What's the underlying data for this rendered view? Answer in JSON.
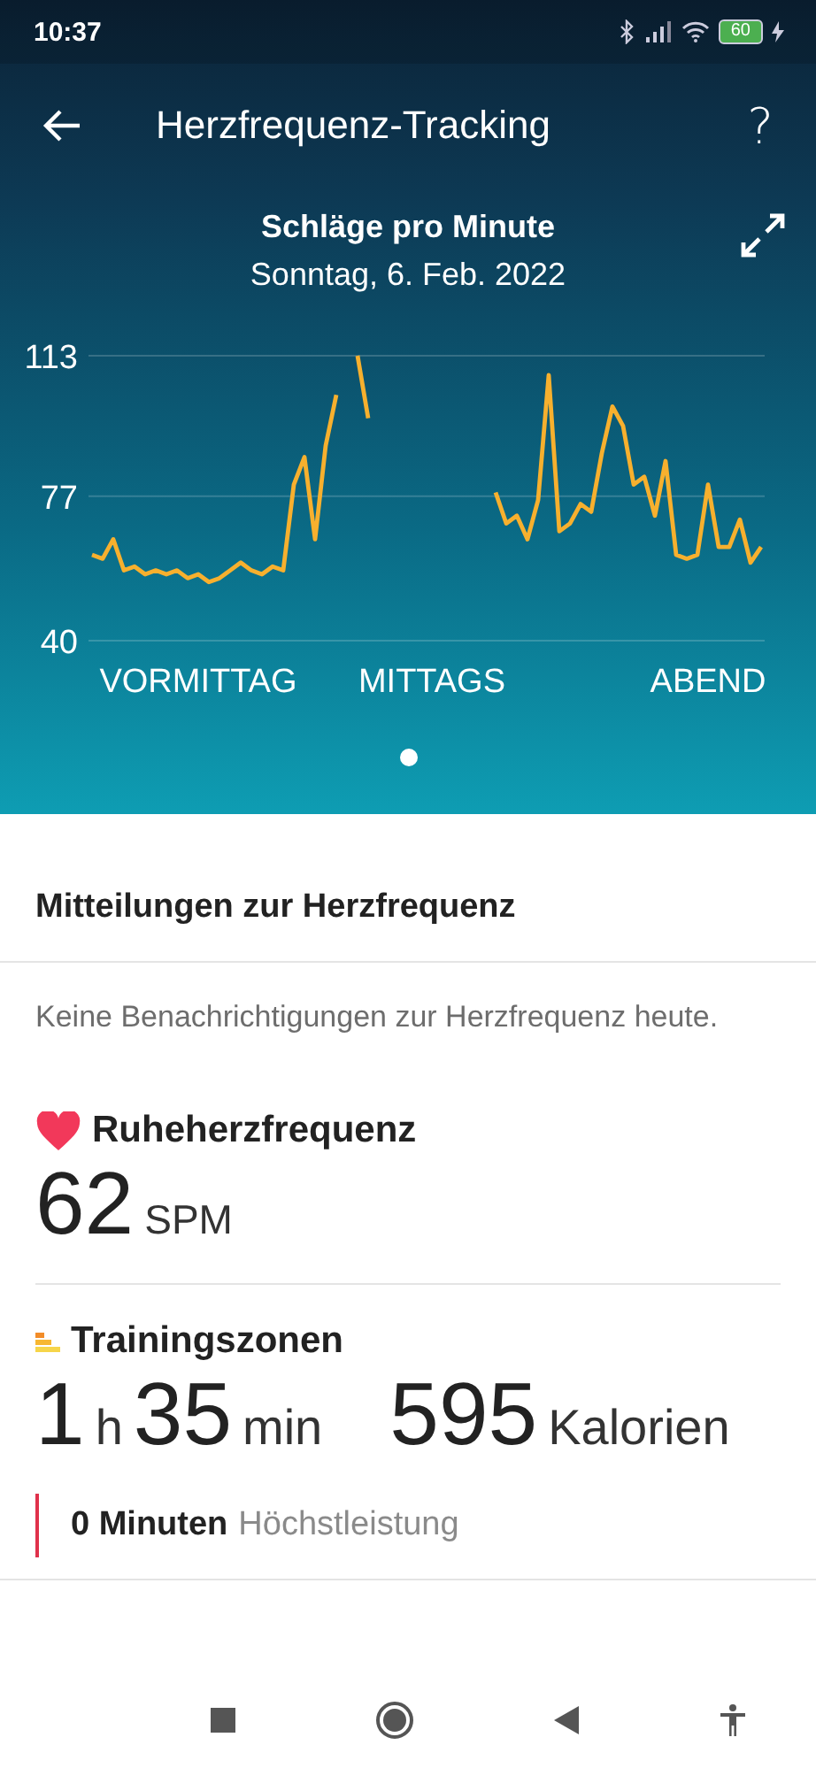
{
  "status_bar": {
    "time": "10:37",
    "battery": "60"
  },
  "app_bar": {
    "title": "Herzfrequenz-Tracking",
    "help": "?"
  },
  "chart_header": {
    "title": "Schläge pro Minute",
    "date": "Sonntag, 6. Feb. 2022"
  },
  "chart_data": {
    "type": "line",
    "ylim": [
      40,
      113
    ],
    "yticks": [
      40,
      77,
      113
    ],
    "categories": [
      null,
      null,
      null,
      null,
      null,
      null,
      null,
      null,
      null,
      null,
      "VORMITTAG",
      null,
      null,
      null,
      null,
      null,
      null,
      null,
      null,
      null,
      null,
      null,
      null,
      null,
      null,
      null,
      null,
      null,
      null,
      null,
      null,
      null,
      "MITTAGS",
      null,
      null,
      null,
      null,
      null,
      null,
      null,
      null,
      null,
      null,
      null,
      null,
      null,
      null,
      null,
      null,
      null,
      null,
      null,
      null,
      null,
      null,
      null,
      null,
      null,
      "ABEND",
      null,
      null,
      null,
      null,
      null
    ],
    "series": [
      {
        "color": "#f7b02e",
        "values": [
          62,
          61,
          66,
          58,
          59,
          57,
          58,
          57,
          58,
          56,
          57,
          55,
          56,
          58,
          60,
          58,
          57,
          59,
          58,
          80,
          87,
          66,
          90,
          103,
          null,
          113,
          97,
          null,
          null,
          null,
          null,
          null,
          null,
          null,
          null,
          null,
          null,
          null,
          78,
          70,
          72,
          66,
          76,
          108,
          68,
          70,
          75,
          73,
          88,
          100,
          95,
          80,
          82,
          72,
          86,
          62,
          61,
          62,
          80,
          64,
          64,
          71,
          60,
          64
        ]
      }
    ]
  },
  "pager": {
    "pages": [
      {
        "selected": true
      }
    ]
  },
  "notifications": {
    "title": "Mitteilungen zur Herzfrequenz",
    "message": "Keine Benachrichtigungen zur Herzfrequenz heute."
  },
  "resting": {
    "title": "Ruheherzfrequenz",
    "value": "62",
    "unit": "SPM"
  },
  "zones": {
    "title": "Trainingszonen",
    "hours": "1",
    "hours_unit": "h",
    "minutes": "35",
    "minutes_unit": "min",
    "calories": "595",
    "calories_unit": "Kalorien",
    "rows": [
      {
        "amount": "0 Minuten",
        "label": "Höchstleistung",
        "color": "#e0314b"
      }
    ]
  }
}
